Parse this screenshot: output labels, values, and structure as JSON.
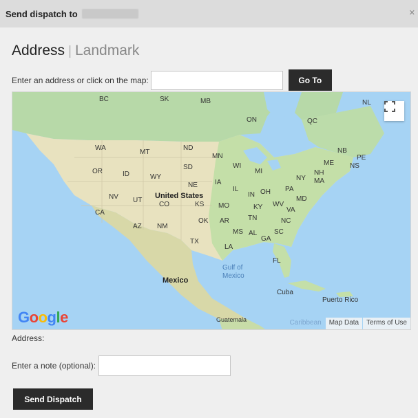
{
  "dialog": {
    "title": "Send dispatch to",
    "close_icon": "close-icon"
  },
  "tabs": {
    "address": "Address",
    "separator": "|",
    "landmark": "Landmark"
  },
  "address_search": {
    "label": "Enter an address or click on the map:",
    "value": "",
    "placeholder": "",
    "go_button": "Go To"
  },
  "map": {
    "provider": "Google",
    "fullscreen_icon": "fullscreen-icon",
    "footer": {
      "caribbean": "Caribbean",
      "map_data": "Map Data",
      "terms": "Terms of Use"
    },
    "labels": {
      "bc": "BC",
      "sk": "SK",
      "mb": "MB",
      "nl": "NL",
      "on": "ON",
      "qc": "QC",
      "wa": "WA",
      "mt": "MT",
      "nd": "ND",
      "mn": "MN",
      "or": "OR",
      "id": "ID",
      "sd": "SD",
      "wy": "WY",
      "wi": "WI",
      "mi": "MI",
      "ne": "NE",
      "ia": "IA",
      "nv": "NV",
      "ut": "UT",
      "us": "United States",
      "co": "CO",
      "ks": "KS",
      "mo": "MO",
      "il": "IL",
      "in": "IN",
      "oh": "OH",
      "pa": "PA",
      "ny": "NY",
      "ca": "CA",
      "az": "AZ",
      "nm": "NM",
      "ok": "OK",
      "ar": "AR",
      "tn": "TN",
      "ky": "KY",
      "wv": "WV",
      "va": "VA",
      "nc": "NC",
      "sc": "SC",
      "tx": "TX",
      "la": "LA",
      "ms": "MS",
      "al": "AL",
      "ga": "GA",
      "fl": "FL",
      "nb": "NB",
      "pe": "PE",
      "me": "ME",
      "ns": "NS",
      "nh": "NH",
      "ma": "MA",
      "md": "MD",
      "mexico": "Mexico",
      "gulf": "Gulf of",
      "gulf2": "Mexico",
      "cuba": "Cuba",
      "pr": "Puerto Rico",
      "guatemala": "Guatemala"
    }
  },
  "address_display": {
    "label": "Address:"
  },
  "note": {
    "label": "Enter a note (optional):",
    "value": "",
    "placeholder": ""
  },
  "send_button": "Send Dispatch"
}
